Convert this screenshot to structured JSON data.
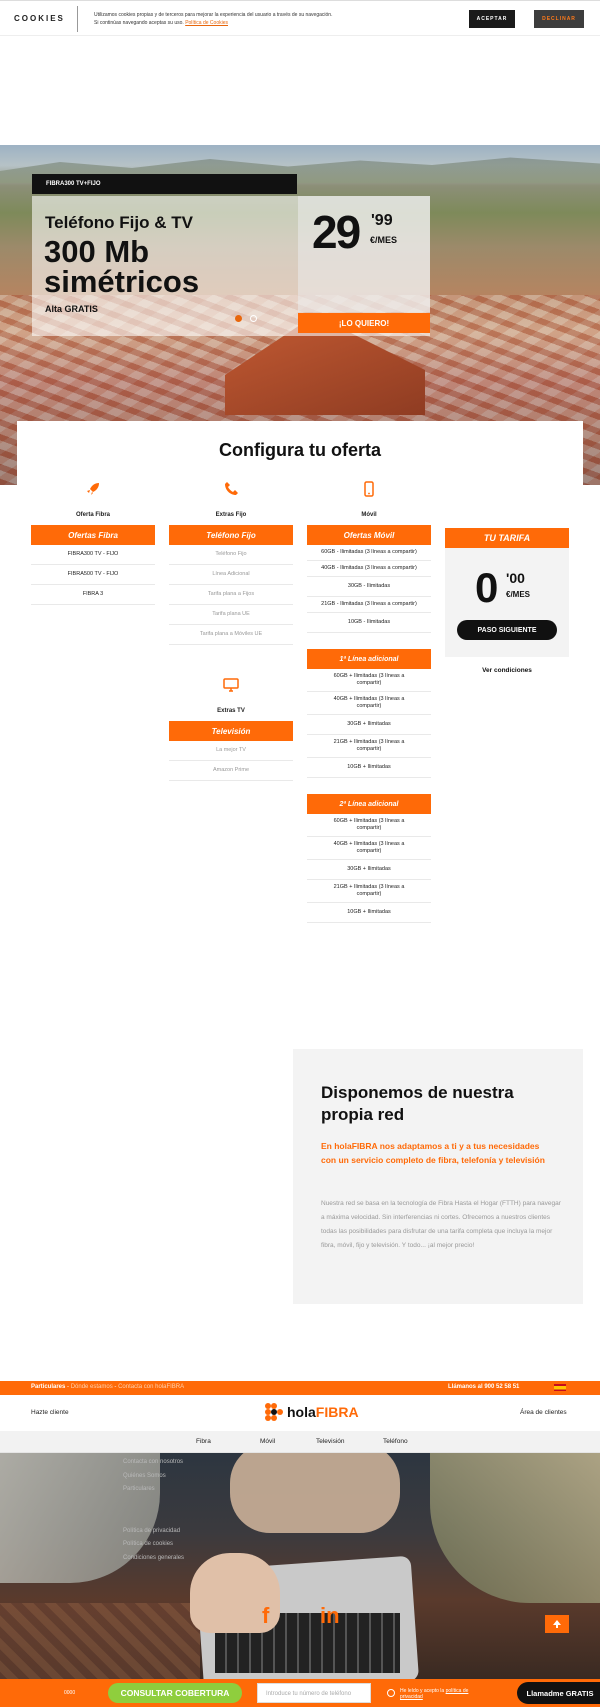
{
  "cookie": {
    "title": "COOKIES",
    "text_line1": "Utilizamos cookies propias y de terceros para mejorar la experiencia del usuario a través de su navegación.",
    "text_line2": "Si continúas navegando aceptas su uso.",
    "policy_link": "Política de Cookies",
    "accept": "ACEPTAR",
    "decline": "DECLINAR"
  },
  "hero": {
    "tag": "FIBRA300 TV+FIJO",
    "subtitle": "Teléfono Fijo & TV",
    "headline": "300 Mb simétricos",
    "alta": "Alta GRATIS",
    "price_int": "29",
    "price_dec": "'99",
    "price_unit": "€/MES",
    "cta": "¡LO QUIERO!"
  },
  "config": {
    "title": "Configura tu oferta",
    "fibra": {
      "caption": "Oferta Fibra",
      "header": "Ofertas Fibra",
      "items": [
        "FIBRA300 TV - FIJO",
        "FIBRA500 TV - FIJO",
        "FIBRA 3"
      ]
    },
    "fijo": {
      "caption": "Extras Fijo",
      "header": "Teléfono Fijo",
      "items": [
        "Teléfono Fijo",
        "Línea Adicional",
        "Tarifa plana a Fijos",
        "Tarifa plana UE",
        "Tarifa plana a Móviles UE"
      ]
    },
    "tv": {
      "caption": "Extras TV",
      "header": "Televisión",
      "items": [
        "La mejor TV",
        "Amazon Prime"
      ]
    },
    "movil": {
      "caption": "Móvil",
      "header": "Ofertas Móvil",
      "items": [
        "60GB - Ilimitadas (3 líneas a compartir)",
        "40GB - Ilimitadas (3 líneas a compartir)",
        "30GB - Ilimitadas",
        "21GB - Ilimitadas (3 líneas a compartir)",
        "10GB - Ilimitadas"
      ],
      "line1_header": "1ª Línea adicional",
      "line1_items": [
        "60GB + Ilimitadas (3 líneas a compartir)",
        "40GB + Ilimitadas (3 líneas a compartir)",
        "30GB + Ilimitadas",
        "21GB + Ilimitadas (3 líneas a compartir)",
        "10GB + Ilimitadas"
      ],
      "line2_header": "2ª Línea adicional",
      "line2_items": [
        "60GB + Ilimitadas (3 líneas a compartir)",
        "40GB + Ilimitadas (3 líneas a compartir)",
        "30GB + Ilimitadas",
        "21GB + Ilimitadas (3 líneas a compartir)",
        "10GB + Ilimitadas"
      ]
    },
    "tarifa": {
      "header": "TU TARIFA",
      "price_int": "0",
      "price_dec": "'00",
      "price_unit": "€/MES",
      "next": "PASO SIGUIENTE",
      "conditions": "Ver condiciones"
    }
  },
  "network": {
    "title": "Disponemos de nuestra propia red",
    "lead": "En holaFIBRA nos adaptamos a ti y a tus necesidades con un servicio completo de fibra, telefonía y televisión",
    "body": "Nuestra red se basa en la tecnología de Fibra Hasta el Hogar (FTTH) para navegar a máxima velocidad. Sin interferencias ni cortes. Ofrecemos a nuestros clientes todas las posibilidades para disfrutar de una tarifa completa que incluya la mejor fibra, móvil, fijo y televisión. Y todo... ¡al mejor precio!"
  },
  "topstrip": {
    "particulares": "Particulares",
    "donde": "Dónde estamos",
    "contacta": "Contacta con holaFIBRA",
    "sep": "-",
    "call": "Llámanos al 900 52 58 51"
  },
  "header": {
    "hazte": "Hazte cliente",
    "logo_hola": "hola",
    "logo_fibra": "FIBRA",
    "area": "Área de clientes"
  },
  "nav": [
    "Fibra",
    "Móvil",
    "Televisión",
    "Teléfono"
  ],
  "footer_menu": [
    "Contacta con nosotros",
    "Quiénes Somos",
    "Particulares",
    "",
    "",
    "Política de privacidad",
    "Política de cookies",
    "Condiciones generales"
  ],
  "social": [
    "f",
    "in"
  ],
  "bottom": {
    "note": "0000",
    "coverage": "CONSULTAR COBERTURA",
    "phone_placeholder": "Introduce tu número de teléfono",
    "legal_prefix": "He leído y acepto la",
    "legal_link": "política de privacidad",
    "call": "Llamadme GRATIS"
  },
  "colors": {
    "accent": "#ff6a08",
    "green": "#8fce3d",
    "dark": "#111111"
  }
}
